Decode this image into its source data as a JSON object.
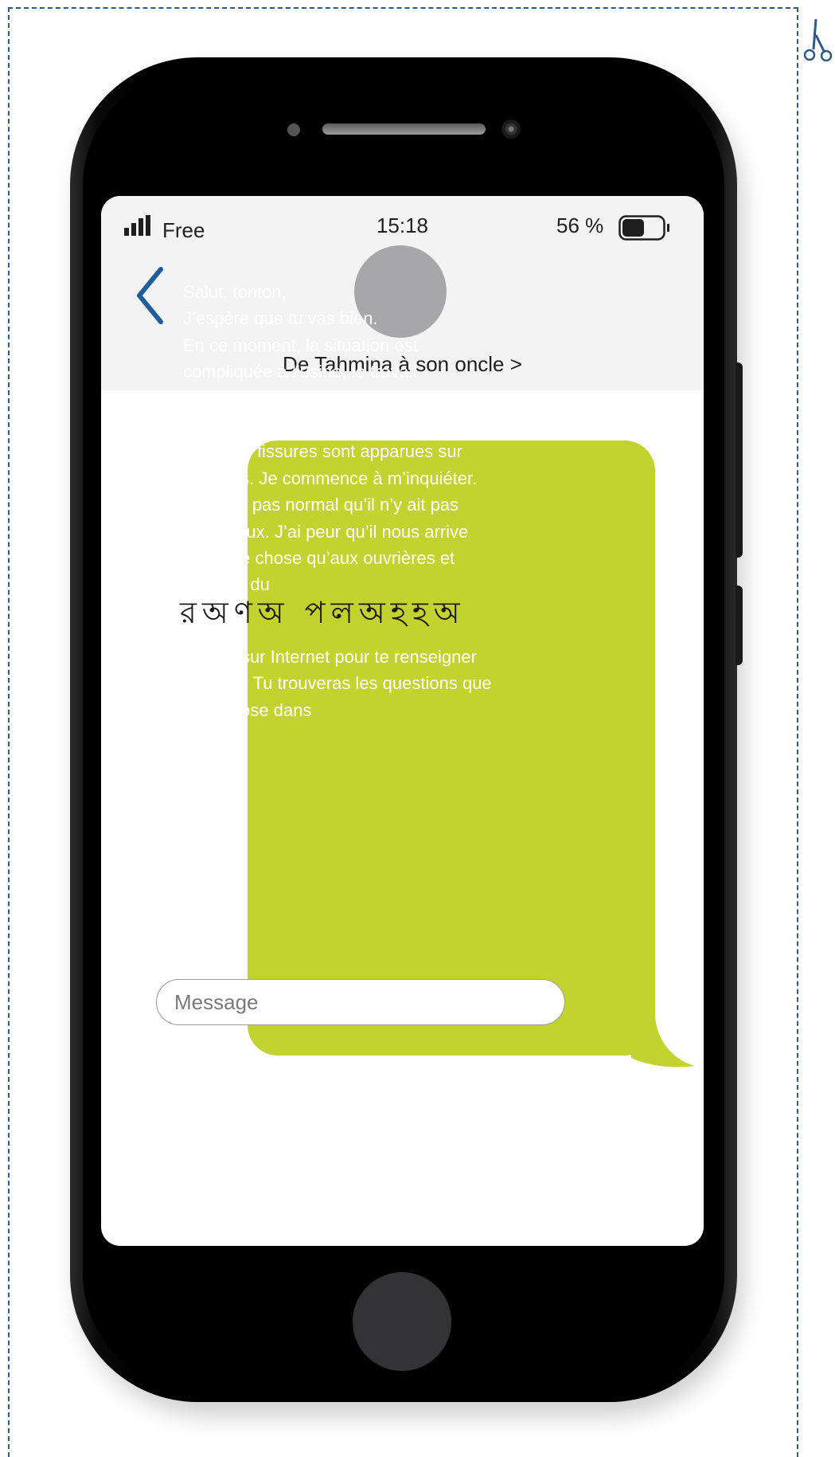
{
  "status_bar": {
    "carrier": "Free",
    "time": "15:18",
    "battery_percent": "56 %",
    "battery_level": 0.56
  },
  "header": {
    "contact_name": "De Tahmina à son oncle >"
  },
  "message": {
    "text_part1": "Salut, tonton,\nJ’espère que tu vas bien.\nEn ce moment, la situation est\ncompliquée à l’usine, le travail\naugmente chaque jour, et le directeur\nrefuse d’augmenter nos salaires.\nHier, des fissures sont apparues sur\nles murs. Je commence à m’inquiéter.\nCe n’est pas normal qu’il n’y ait pas\nde travaux. J’ai peur qu’il nous arrive\nla même chose qu’aux ouvrières et\nouvriers du",
    "bengali_text": "রঅণঅ পলঅহহঅ",
    "text_part2": "Va voir sur Internet pour te renseigner\ndessus ! Tu trouveras les questions que\nje me pose dans"
  },
  "composer": {
    "placeholder": "Message"
  },
  "colors": {
    "bubble": "#c3d22f",
    "back_chevron": "#1f5d99",
    "cut_line": "#2f5a88"
  }
}
